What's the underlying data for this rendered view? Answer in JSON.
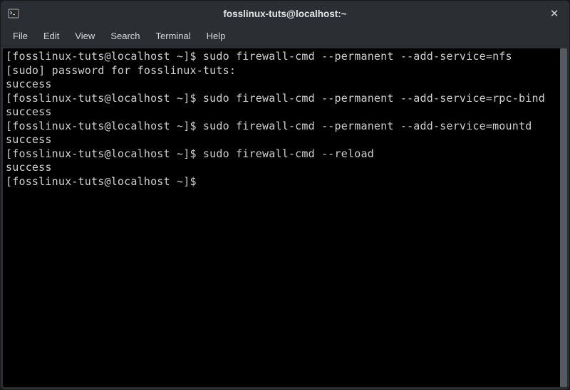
{
  "window": {
    "title": "fosslinux-tuts@localhost:~"
  },
  "menu": {
    "items": [
      "File",
      "Edit",
      "View",
      "Search",
      "Terminal",
      "Help"
    ]
  },
  "terminal": {
    "lines": [
      "[fosslinux-tuts@localhost ~]$ sudo firewall-cmd --permanent --add-service=nfs",
      "[sudo] password for fosslinux-tuts:",
      "success",
      "[fosslinux-tuts@localhost ~]$ sudo firewall-cmd --permanent --add-service=rpc-bind",
      "success",
      "[fosslinux-tuts@localhost ~]$ sudo firewall-cmd --permanent --add-service=mountd",
      "success",
      "[fosslinux-tuts@localhost ~]$ sudo firewall-cmd --reload",
      "success",
      "[fosslinux-tuts@localhost ~]$ "
    ]
  }
}
